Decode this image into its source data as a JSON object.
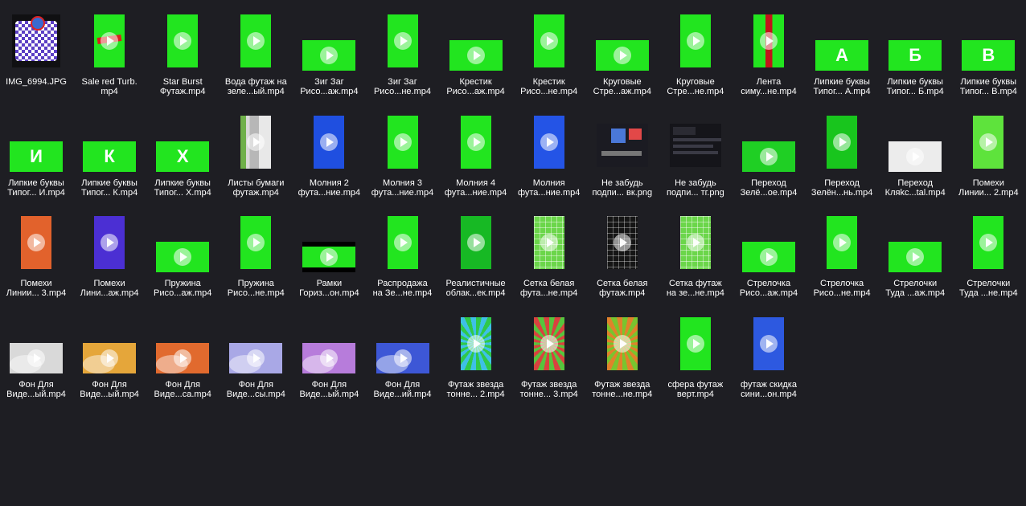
{
  "colors": {
    "background": "#1e1e23",
    "green": "#22e51f",
    "label": "#ffffff"
  },
  "files": [
    {
      "line1": "IMG_6994.JPG",
      "line2": "",
      "kind": "qr-image",
      "shape": "portrait"
    },
    {
      "line1": "Sale red Turb.",
      "line2": "mp4",
      "kind": "sale",
      "shape": "portrait"
    },
    {
      "line1": "Star Burst",
      "line2": "Футаж.mp4",
      "kind": "green",
      "shape": "portrait"
    },
    {
      "line1": "Вода футаж на",
      "line2": "зеле...ый.mp4",
      "kind": "green",
      "shape": "portrait"
    },
    {
      "line1": "Зиг Заг",
      "line2": "Рисо...аж.mp4",
      "kind": "green",
      "shape": "landscape"
    },
    {
      "line1": "Зиг Заг",
      "line2": "Рисо...не.mp4",
      "kind": "green",
      "shape": "portrait"
    },
    {
      "line1": "Крестик",
      "line2": "Рисо...аж.mp4",
      "kind": "green",
      "shape": "landscape"
    },
    {
      "line1": "Крестик",
      "line2": "Рисо...не.mp4",
      "kind": "green",
      "shape": "portrait"
    },
    {
      "line1": "Круговые",
      "line2": "Стре...аж.mp4",
      "kind": "green",
      "shape": "landscape"
    },
    {
      "line1": "Круговые",
      "line2": "Стре...не.mp4",
      "kind": "green",
      "shape": "portrait"
    },
    {
      "line1": "Лента",
      "line2": "симу...не.mp4",
      "kind": "ribbon",
      "shape": "portrait"
    },
    {
      "line1": "Липкие буквы",
      "line2": "Типог... А.mp4",
      "kind": "letter",
      "glyph": "А",
      "shape": "landscape"
    },
    {
      "line1": "Липкие буквы",
      "line2": "Типог... Б.mp4",
      "kind": "letter",
      "glyph": "Б",
      "shape": "landscape"
    },
    {
      "line1": "Липкие буквы",
      "line2": "Типог... В.mp4",
      "kind": "letter",
      "glyph": "В",
      "shape": "landscape"
    },
    {
      "line1": "Липкие буквы",
      "line2": "Типог... И.mp4",
      "kind": "letter",
      "glyph": "И",
      "shape": "landscape"
    },
    {
      "line1": "Липкие буквы",
      "line2": "Типог... К.mp4",
      "kind": "letter",
      "glyph": "К",
      "shape": "landscape"
    },
    {
      "line1": "Липкие буквы",
      "line2": "Типог... Х.mp4",
      "kind": "letter",
      "glyph": "Х",
      "shape": "landscape"
    },
    {
      "line1": "Листы бумаги",
      "line2": "футаж.mp4",
      "kind": "paper",
      "shape": "portrait"
    },
    {
      "line1": "Молния 2",
      "line2": "фута...ние.mp4",
      "kind": "blue",
      "shape": "portrait"
    },
    {
      "line1": "Молния 3",
      "line2": "фута...ние.mp4",
      "kind": "green",
      "shape": "portrait"
    },
    {
      "line1": "Молния 4",
      "line2": "фута...ние.mp4",
      "kind": "green",
      "shape": "portrait"
    },
    {
      "line1": "Молния",
      "line2": "фута...ние.mp4",
      "kind": "blue-yellow",
      "shape": "portrait"
    },
    {
      "line1": "Не забудь",
      "line2": "подпи... вк.png",
      "kind": "screenshot",
      "shape": "landscape-small"
    },
    {
      "line1": "Не забудь",
      "line2": "подпи... тг.png",
      "kind": "screenshot-dark",
      "shape": "landscape-small"
    },
    {
      "line1": "Переход",
      "line2": "Зелё...ое.mp4",
      "kind": "green-dark",
      "shape": "landscape"
    },
    {
      "line1": "Переход",
      "line2": "Зелён...нь.mp4",
      "kind": "green-blob",
      "shape": "portrait"
    },
    {
      "line1": "Переход",
      "line2": "Кляkc...tal.mp4",
      "kind": "white",
      "shape": "landscape"
    },
    {
      "line1": "Помехи",
      "line2": "Линии... 2.mp4",
      "kind": "lime",
      "shape": "portrait"
    },
    {
      "line1": "Помехи",
      "line2": "Линии... 3.mp4",
      "kind": "orange",
      "shape": "portrait"
    },
    {
      "line1": "Помехи",
      "line2": "Лини...аж.mp4",
      "kind": "violet",
      "shape": "portrait"
    },
    {
      "line1": "Пружина",
      "line2": "Рисо...аж.mp4",
      "kind": "green",
      "shape": "landscape"
    },
    {
      "line1": "Пружина",
      "line2": "Рисо...не.mp4",
      "kind": "green",
      "shape": "portrait"
    },
    {
      "line1": "Рамки",
      "line2": "Гориз...он.mp4",
      "kind": "frame",
      "shape": "landscape"
    },
    {
      "line1": "Распродажа",
      "line2": "на Зе...не.mp4",
      "kind": "sale-vertical",
      "shape": "portrait"
    },
    {
      "line1": "Реалистичные",
      "line2": "облак...ек.mp4",
      "kind": "green-cloud",
      "shape": "portrait"
    },
    {
      "line1": "Сетка белая",
      "line2": "фута...не.mp4",
      "kind": "lime-grid",
      "shape": "portrait"
    },
    {
      "line1": "Сетка белая",
      "line2": "футаж.mp4",
      "kind": "dark-grid",
      "shape": "portrait"
    },
    {
      "line1": "Сетка футаж",
      "line2": "на зе...не.mp4",
      "kind": "lime-grid",
      "shape": "portrait"
    },
    {
      "line1": "Стрелочка",
      "line2": "Рисо...аж.mp4",
      "kind": "green",
      "shape": "landscape"
    },
    {
      "line1": "Стрелочка",
      "line2": "Рисо...не.mp4",
      "kind": "green",
      "shape": "portrait"
    },
    {
      "line1": "Стрелочки",
      "line2": "Туда ...аж.mp4",
      "kind": "green",
      "shape": "landscape"
    },
    {
      "line1": "Стрелочки",
      "line2": "Туда ...не.mp4",
      "kind": "green",
      "shape": "portrait"
    },
    {
      "line1": "Фон Для",
      "line2": "Виде...ый.mp4",
      "kind": "grey-wave",
      "shape": "landscape"
    },
    {
      "line1": "Фон Для",
      "line2": "Виде...ый.mp4",
      "kind": "yellow-wave",
      "shape": "landscape"
    },
    {
      "line1": "Фон Для",
      "line2": "Виде...са.mp4",
      "kind": "orange-wave",
      "shape": "landscape"
    },
    {
      "line1": "Фон Для",
      "line2": "Виде...сы.mp4",
      "kind": "lavender-wave",
      "shape": "landscape"
    },
    {
      "line1": "Фон Для",
      "line2": "Виде...ый.mp4",
      "kind": "purple-wave",
      "shape": "landscape"
    },
    {
      "line1": "Фон Для",
      "line2": "Виде...ий.mp4",
      "kind": "blue-wave",
      "shape": "landscape"
    },
    {
      "line1": "Футаж звезда",
      "line2": "тонне... 2.mp4",
      "kind": "burst-blue",
      "shape": "portrait"
    },
    {
      "line1": "Футаж звезда",
      "line2": "тонне... 3.mp4",
      "kind": "burst-red",
      "shape": "portrait"
    },
    {
      "line1": "Футаж звезда",
      "line2": "тонне...не.mp4",
      "kind": "burst-orange",
      "shape": "portrait"
    },
    {
      "line1": "сфера футаж",
      "line2": "верт.mp4",
      "kind": "green-sphere",
      "shape": "portrait"
    },
    {
      "line1": "футаж скидка",
      "line2": "сини...он.mp4",
      "kind": "blue-discount",
      "shape": "portrait"
    }
  ]
}
